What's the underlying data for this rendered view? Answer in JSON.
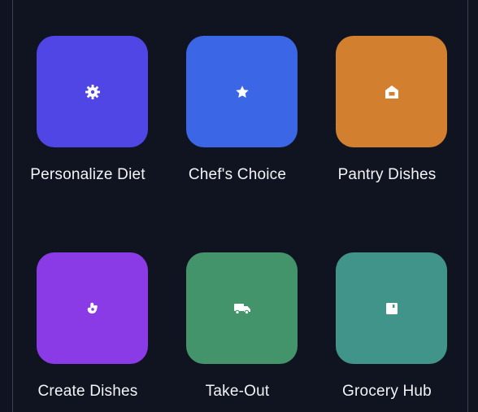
{
  "tiles": [
    {
      "label": "Personalize Diet",
      "color": "#4f46e5",
      "icon": "gear-icon"
    },
    {
      "label": "Chef's Choice",
      "color": "#3b66e6",
      "icon": "star-icon"
    },
    {
      "label": "Pantry Dishes",
      "color": "#d27f30",
      "icon": "home-icon"
    },
    {
      "label": "Create Dishes",
      "color": "#8b3be6",
      "icon": "hand-icon"
    },
    {
      "label": "Take-Out",
      "color": "#43946b",
      "icon": "truck-icon"
    },
    {
      "label": "Grocery Hub",
      "color": "#41948a",
      "icon": "store-icon"
    }
  ]
}
